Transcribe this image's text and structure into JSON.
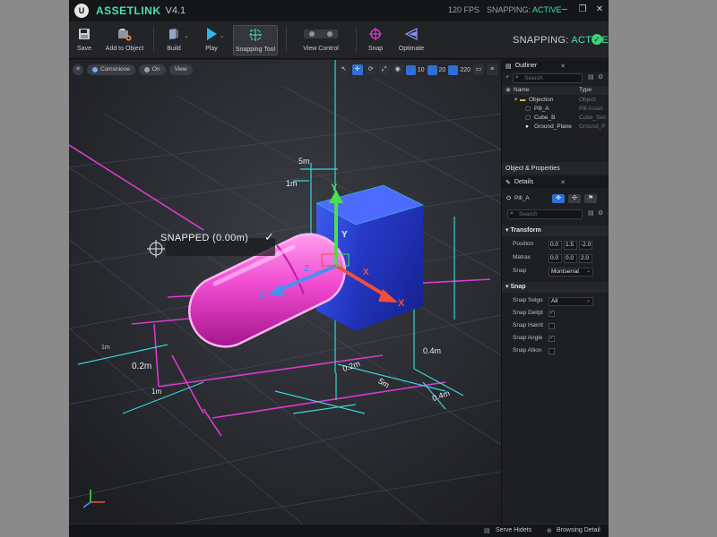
{
  "app": {
    "logo": "U",
    "title": "ASSETLINK",
    "version": "V4.1",
    "fps": "120 FPS",
    "snapping_status_label": "SNAPPING:",
    "snapping_status_value": "ACTIVE"
  },
  "toolbar": {
    "items": [
      {
        "label": "Save",
        "icon": "save-icon"
      },
      {
        "label": "Add to Object",
        "icon": "add-object-icon"
      },
      {
        "label": "Build",
        "icon": "build-icon"
      },
      {
        "label": "Play",
        "icon": "play-icon"
      },
      {
        "label": "Snapping Tool",
        "icon": "snapping-tool-icon"
      },
      {
        "label": "View Control",
        "icon": "view-control-icon"
      },
      {
        "label": "Snap",
        "icon": "snap-icon"
      },
      {
        "label": "Optimate",
        "icon": "optimate-icon"
      }
    ],
    "snapping_label": "SNAPPING:",
    "snapping_value": "ACTIVE"
  },
  "viewport": {
    "chips": [
      "Comsnione",
      "On",
      "View"
    ],
    "tool_values": [
      "10",
      "20",
      "220"
    ],
    "snapped_label": "SNAPPED (0.00m)",
    "dimensions": [
      "5m",
      "1m",
      "0.2m",
      "1m",
      "1m",
      "0.2m",
      "5m",
      "0.4m",
      "0.4m"
    ],
    "axis_labels": [
      "Y",
      "X",
      "Z",
      "Y",
      "X",
      "Z"
    ],
    "colors": {
      "accent": "#48e0b8",
      "pill": "#ff5fd8",
      "cube": "#3550e8",
      "grid_cyan": "#39e6e8",
      "grid_magenta": "#e43cd8"
    }
  },
  "outliner": {
    "title": "Outliner",
    "search_placeholder": "Search",
    "col_name": "Name",
    "col_type": "Type",
    "rows": [
      {
        "name": "Objection",
        "type": "Object"
      },
      {
        "name": "Pill_A",
        "type": "Pill Asset"
      },
      {
        "name": "Cube_B",
        "type": "Cube_Sec"
      },
      {
        "name": "Ground_Plane",
        "type": "Ground_P"
      }
    ]
  },
  "object_properties": {
    "title": "Object & Properties"
  },
  "details": {
    "title": "Details",
    "object_name": "Pill_A",
    "search_placeholder": "Search",
    "transform_title": "Transform",
    "position_label": "Position",
    "position": [
      "0.0",
      "1.5",
      "-2.0"
    ],
    "matrix_label": "Matrax",
    "matrix": [
      "0.0",
      "0.0",
      "2.0"
    ],
    "snap_label": "Snap",
    "snap_value": "Montserrat",
    "snap_section_title": "Snap",
    "snap_selgo_label": "Snap Selgo",
    "snap_selgo_value": "All",
    "snap_rows": [
      {
        "label": "Snap Deitpt",
        "checked": true
      },
      {
        "label": "Snap Hakrit",
        "checked": false
      },
      {
        "label": "Snap Angle",
        "checked": true
      },
      {
        "label": "Snap Allion",
        "checked": false
      }
    ]
  },
  "statusbar": {
    "left": "Serve Hidets",
    "right": "Browsing Detail"
  }
}
